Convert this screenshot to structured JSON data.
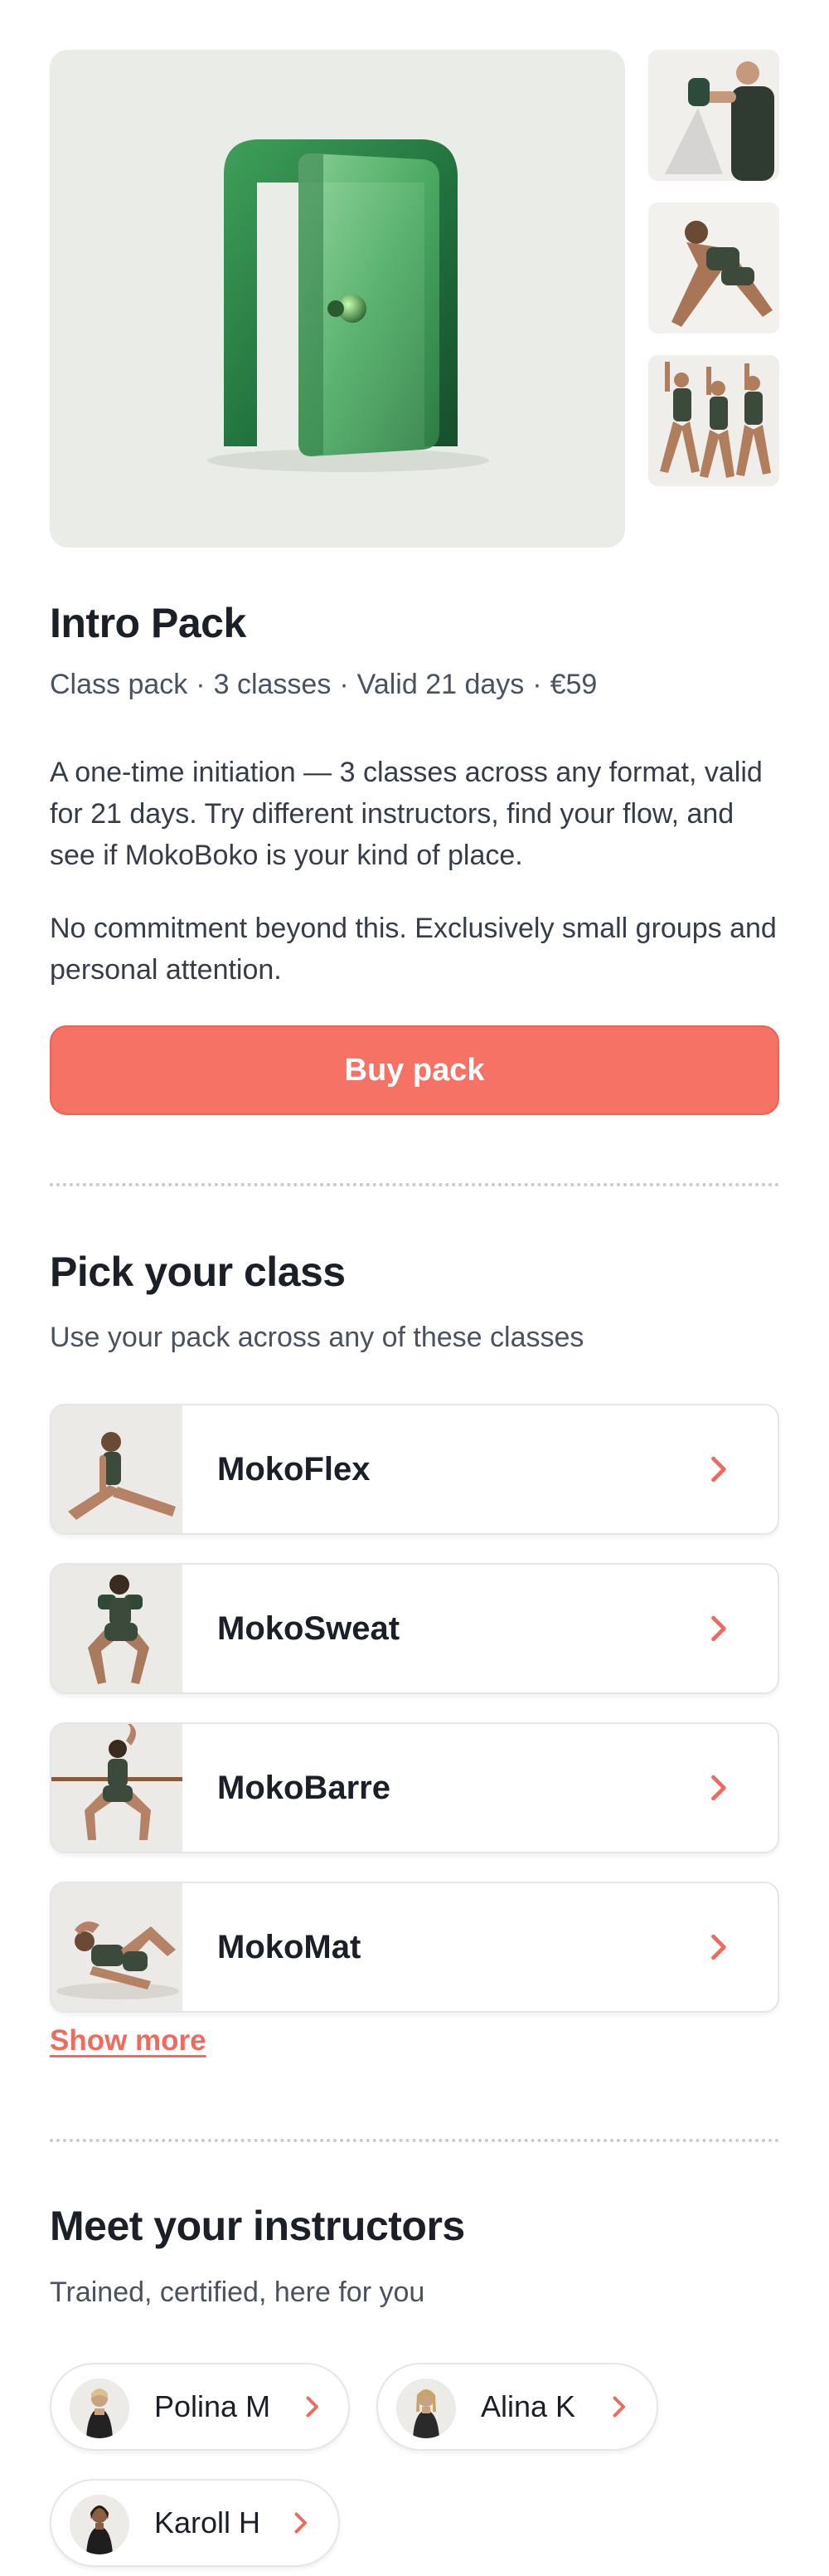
{
  "gallery": {
    "hero_image": "green-door-illustration",
    "thumbnails": [
      "dumbbell-curl-photo",
      "lunge-stretch-photo",
      "group-barre-photo"
    ]
  },
  "pack": {
    "title": "Intro Pack",
    "meta": [
      "Class pack",
      "3 classes",
      "Valid 21 days",
      "€59"
    ],
    "description_1": "A one-time initiation — 3 classes across any format, valid for 21 days. Try different instructors, find your flow, and see if MokoBoko is your kind of place.",
    "description_2": "No commitment beyond this. Exclusively small groups and personal attention.",
    "buy_label": "Buy pack"
  },
  "classes": {
    "heading": "Pick your class",
    "subheading": "Use your pack across any of these classes",
    "items": [
      {
        "label": "MokoFlex",
        "image": "split-stretch-photo"
      },
      {
        "label": "MokoSweat",
        "image": "squat-dumbbells-photo"
      },
      {
        "label": "MokoBarre",
        "image": "plie-barre-photo"
      },
      {
        "label": "MokoMat",
        "image": "crunch-mat-photo"
      }
    ],
    "show_more": "Show more"
  },
  "instructors": {
    "heading": "Meet your instructors",
    "subheading": "Trained, certified, here for you",
    "items": [
      {
        "name": "Polina M"
      },
      {
        "name": "Alina K"
      },
      {
        "name": "Karoll H"
      }
    ]
  },
  "colors": {
    "accent": "#f67265",
    "hero_bg": "#e9ece7",
    "door_green": "#2e8a4a"
  },
  "icons": {
    "chevron": "chevron-right-icon"
  }
}
